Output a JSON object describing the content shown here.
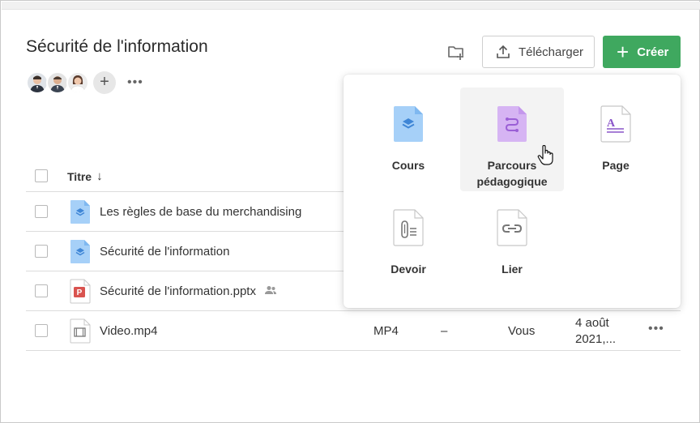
{
  "page": {
    "title": "Sécurité de l'information"
  },
  "toolbar": {
    "upload_label": "Télécharger",
    "create_label": "Créer",
    "create_plus": "+"
  },
  "members": {
    "add_symbol": "+",
    "more_symbol": "•••"
  },
  "table": {
    "header": {
      "title": "Titre",
      "sort_arrow": "↓"
    },
    "rows": [
      {
        "name": "Les règles de base du merchandising",
        "icon": "course-file-icon",
        "type": "",
        "size": "",
        "owner": "",
        "date": ""
      },
      {
        "name": "Sécurité de l'information",
        "icon": "course-file-icon",
        "type": "",
        "size": "",
        "owner": "",
        "date": ""
      },
      {
        "name": "Sécurité de l'information.pptx",
        "icon": "pptx-file-icon",
        "shared": true,
        "type": "",
        "size": "",
        "owner": "",
        "date": ""
      },
      {
        "name": "Video.mp4",
        "icon": "video-file-icon",
        "type": "MP4",
        "size": "–",
        "owner": "Vous",
        "date": "4 août 2021,...",
        "more": "•••"
      }
    ]
  },
  "create_menu": {
    "items": [
      {
        "label": "Cours",
        "icon": "course-icon"
      },
      {
        "label": "Parcours pédagogique",
        "icon": "learning-path-icon"
      },
      {
        "label": "Page",
        "icon": "page-icon"
      },
      {
        "label": "Devoir",
        "icon": "assignment-icon"
      },
      {
        "label": "Lier",
        "icon": "link-icon"
      }
    ]
  },
  "colors": {
    "create_button": "#3fa85f",
    "course_icon": "#a6d0f8",
    "learning_path_icon": "#d6b4f3",
    "pptx_icon": "#d9534f"
  }
}
